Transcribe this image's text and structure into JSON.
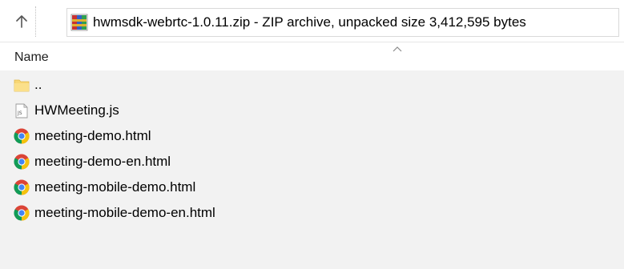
{
  "toolbar": {
    "up_icon": "up-arrow-icon",
    "address": {
      "icon": "winrar-archive-icon",
      "text": "hwmsdk-webrtc-1.0.11.zip - ZIP archive, unpacked size 3,412,595 bytes"
    }
  },
  "columns": {
    "name": "Name",
    "sort_icon": "sort-ascending-chevron-icon"
  },
  "files": [
    {
      "name": "..",
      "icon": "folder-icon"
    },
    {
      "name": "HWMeeting.js",
      "icon": "js-file-icon"
    },
    {
      "name": "meeting-demo.html",
      "icon": "chrome-html-icon"
    },
    {
      "name": "meeting-demo-en.html",
      "icon": "chrome-html-icon"
    },
    {
      "name": "meeting-mobile-demo.html",
      "icon": "chrome-html-icon"
    },
    {
      "name": "meeting-mobile-demo-en.html",
      "icon": "chrome-html-icon"
    }
  ],
  "colors": {
    "list_background": "#f2f2f2",
    "folder": "#f8d775",
    "chrome_red": "#db4437",
    "chrome_yellow": "#f4c20d",
    "chrome_green": "#0f9d58",
    "chrome_blue": "#4285f4"
  }
}
